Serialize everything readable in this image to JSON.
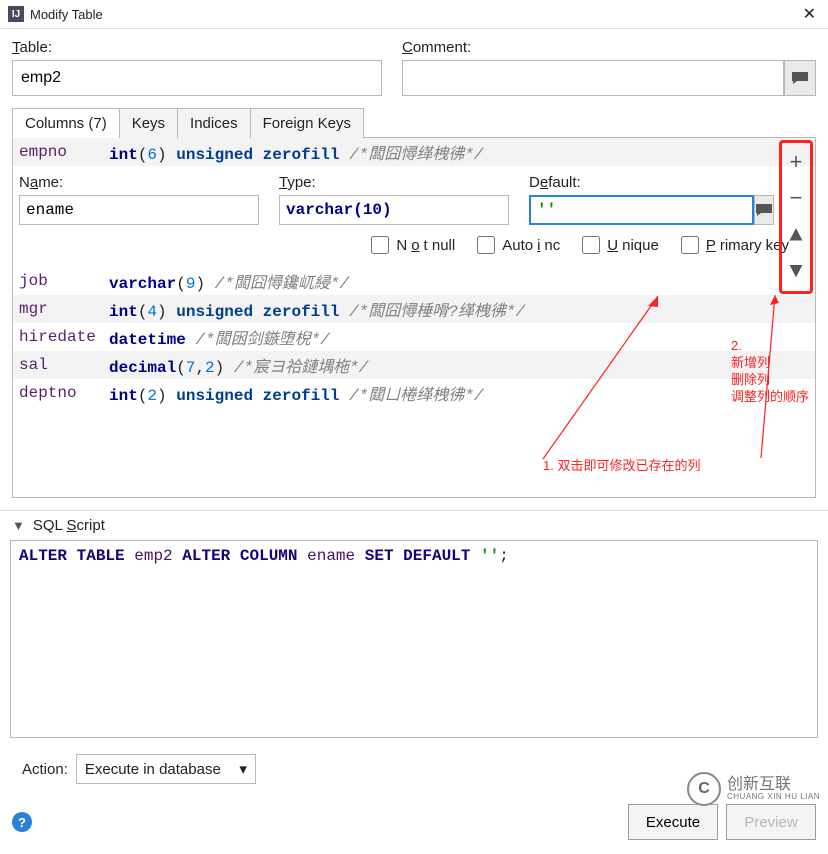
{
  "titlebar": {
    "title": "Modify Table"
  },
  "labels": {
    "table": "Table:",
    "comment": "Comment:",
    "name": "Name:",
    "type": "Type:",
    "default": "Default:",
    "not_null": "Not null",
    "auto_inc": "Auto inc",
    "unique": "Unique",
    "primary_key": "Primary key",
    "sql_script": "SQL Script",
    "action": "Action:"
  },
  "table_name": "emp2",
  "comment_value": "",
  "tabs": {
    "columns": "Columns (7)",
    "keys": "Keys",
    "indices": "Indices",
    "foreign_keys": "Foreign Keys"
  },
  "columns": [
    {
      "name": "empno",
      "type_html": "<span class='kw'>int</span>(<span class='num'>6</span>) <span class='kw2'>unsigned</span> <span class='kw2'>zerofill</span> <span class='cmt'>/*闆囧憳缂栧彿*/</span>"
    },
    {
      "name": "job",
      "type_html": "<span class='kw'>varchar</span>(<span class='num'>9</span>) <span class='cmt'>/*闆囧憳鑱屼綅*/</span>"
    },
    {
      "name": "mgr",
      "type_html": "<span class='kw'>int</span>(<span class='num'>4</span>) <span class='kw2'>unsigned</span> <span class='kw2'>zerofill</span> <span class='cmt'>/*闆囧憳棰嗗?缂栧彿*/</span>"
    },
    {
      "name": "hiredate",
      "type_html": "<span class='kw'>datetime</span> <span class='cmt'>/*闆囦剑鏃堕棿*/</span>"
    },
    {
      "name": "sal",
      "type_html": "<span class='kw'>decimal</span>(<span class='num'>7</span>,<span class='num'>2</span>) <span class='cmt'>/*宸ヨ祫鏈堣柂*/</span>"
    },
    {
      "name": "deptno",
      "type_html": "<span class='kw'>int</span>(<span class='num'>2</span>) <span class='kw2'>unsigned</span> <span class='kw2'>zerofill</span> <span class='cmt'>/*閮ㄩ棬缂栧彿*/</span>"
    }
  ],
  "edit": {
    "name": "ename",
    "type": "varchar(10)",
    "default": "''",
    "not_null": false,
    "auto_inc": false,
    "unique": false,
    "primary_key": false
  },
  "side_tools": {
    "add": "+",
    "remove": "−",
    "up": "▲",
    "down": "▼"
  },
  "annotations": {
    "num2_label": "2.\n新增列\n删除列\n调整列的顺序",
    "num1_label": "1. 双击即可修改已存在的列"
  },
  "sql": {
    "tokens": [
      {
        "t": "ALTER",
        "c": "sql-kw"
      },
      {
        "t": " "
      },
      {
        "t": "TABLE",
        "c": "sql-kw"
      },
      {
        "t": " "
      },
      {
        "t": "emp2",
        "c": "sql-id"
      },
      {
        "t": " "
      },
      {
        "t": "ALTER",
        "c": "sql-kw"
      },
      {
        "t": " "
      },
      {
        "t": "COLUMN",
        "c": "sql-kw"
      },
      {
        "t": " "
      },
      {
        "t": "ename",
        "c": "sql-id"
      },
      {
        "t": " "
      },
      {
        "t": "SET",
        "c": "sql-kw"
      },
      {
        "t": " "
      },
      {
        "t": "DEFAULT",
        "c": "sql-kw"
      },
      {
        "t": " "
      },
      {
        "t": "''",
        "c": "sql-str"
      },
      {
        "t": ";"
      }
    ]
  },
  "action_select": "Execute in database",
  "buttons": {
    "execute": "Execute",
    "preview": "Preview"
  },
  "watermark": {
    "text": "创新互联",
    "sub": "CHUANG XIN HU LIAN"
  }
}
